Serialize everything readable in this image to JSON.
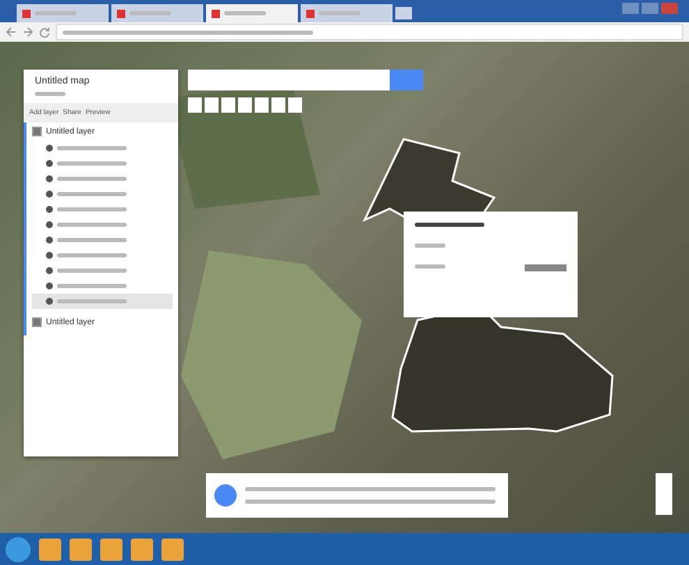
{
  "browser": {
    "tabs": [
      {
        "selected": false
      },
      {
        "selected": false
      },
      {
        "selected": true
      },
      {
        "selected": false
      }
    ]
  },
  "sidebar": {
    "title": "Untitled map",
    "actions": [
      "Add layer",
      "Share",
      "Preview"
    ],
    "layers": [
      {
        "name": "Untitled layer",
        "checked": true,
        "items": [
          {
            "selected": false
          },
          {
            "selected": false
          },
          {
            "selected": false
          },
          {
            "selected": false
          },
          {
            "selected": false
          },
          {
            "selected": false
          },
          {
            "selected": false
          },
          {
            "selected": false
          },
          {
            "selected": false
          },
          {
            "selected": false
          },
          {
            "selected": true
          }
        ]
      },
      {
        "name": "Untitled layer",
        "checked": true
      }
    ]
  }
}
